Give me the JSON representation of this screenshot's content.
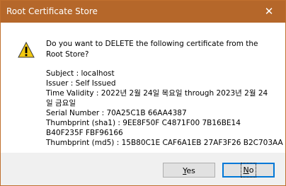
{
  "window": {
    "title": "Root Certificate Store"
  },
  "controls": {
    "close_glyph": "✕"
  },
  "message": {
    "question": "Do you want to DELETE the following certificate from the Root Store?",
    "subject": "Subject : localhost",
    "issuer": "Issuer : Self Issued",
    "validity": "Time Validity : 2022년 2월 24일 목요일 through 2023년 2월 24일 금요일",
    "serial": "Serial Number : 70A25C1B 66AA4387",
    "thumb_sha1": "Thumbprint (sha1) : 9EE8F50F C4871F00 7B16BE14 B40F235F FBF96166",
    "thumb_md5": "Thumbprint (md5) : 15B80C1E CAF6A1EB 27AF3F26 B2C703AA"
  },
  "buttons": {
    "yes_mnemonic": "Y",
    "yes_rest": "es",
    "no_mnemonic": "N",
    "no_rest": "o"
  },
  "colors": {
    "titlebar": "#b5672a",
    "warning_fill": "#f2c811",
    "focus_border": "#0078d7"
  },
  "icons": {
    "warning": "warning-icon",
    "close": "close-icon"
  }
}
